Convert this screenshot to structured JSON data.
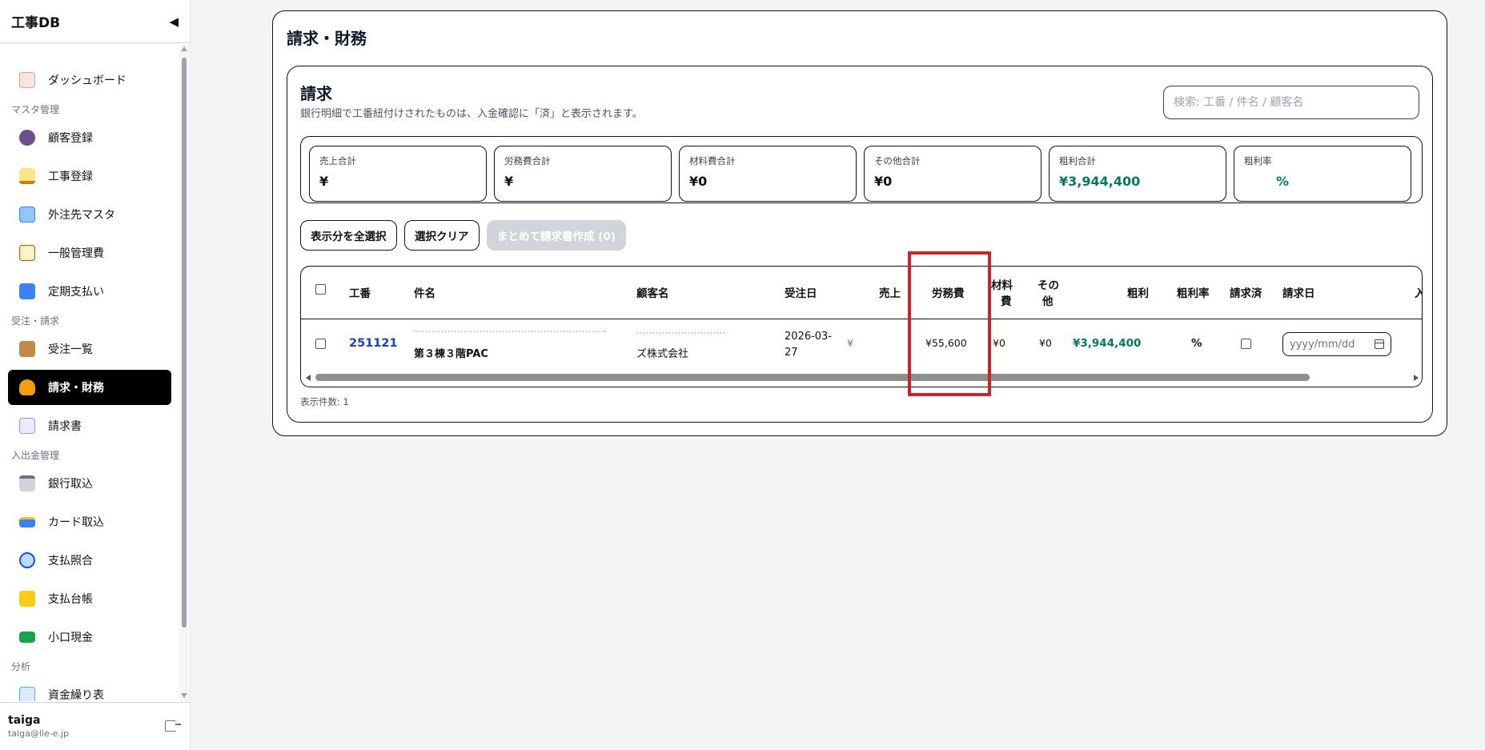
{
  "sidebar": {
    "brand": "工事DB",
    "collapse_glyph": "◀",
    "sections": {
      "master": "マスタ管理",
      "orders": "受注・請求",
      "cash": "入出金管理",
      "analysis": "分析"
    },
    "items": [
      {
        "label": "ダッシュボード",
        "icon": "bar-chart-icon",
        "color": "#e8b4b8"
      },
      {
        "label": "顧客登録",
        "icon": "users-icon",
        "color": "#6d4f8f"
      },
      {
        "label": "工事登録",
        "icon": "construction-icon",
        "color": "#d97706"
      },
      {
        "label": "外注先マスタ",
        "icon": "building-icon",
        "color": "#60a5fa"
      },
      {
        "label": "一般管理費",
        "icon": "clipboard-icon",
        "color": "#e5c07b"
      },
      {
        "label": "定期支払い",
        "icon": "repeat-icon",
        "color": "#3b82f6"
      },
      {
        "label": "受注一覧",
        "icon": "package-icon",
        "color": "#b45309"
      },
      {
        "label": "請求・財務",
        "icon": "money-bag-icon",
        "color": "#f59e0b"
      },
      {
        "label": "請求書",
        "icon": "document-icon",
        "color": "#c4b5fd"
      },
      {
        "label": "銀行取込",
        "icon": "bank-icon",
        "color": "#9ca3af"
      },
      {
        "label": "カード取込",
        "icon": "credit-card-icon",
        "color": "#3b82f6"
      },
      {
        "label": "支払照合",
        "icon": "magnifier-icon",
        "color": "#2563eb"
      },
      {
        "label": "支払台帳",
        "icon": "ledger-icon",
        "color": "#facc15"
      },
      {
        "label": "小口現金",
        "icon": "cash-icon",
        "color": "#16a34a"
      },
      {
        "label": "資金繰り表",
        "icon": "chart-icon",
        "color": "#93c5fd"
      }
    ],
    "active_item": "請求・財務",
    "user": {
      "name": "taiga",
      "email": "taiga@lle-e.jp"
    }
  },
  "page": {
    "title": "請求・財務",
    "section_title": "請求",
    "section_desc": "銀行明細で工番紐付けされたものは、入金確認に「済」と表示されます。",
    "search_placeholder": "検索: 工番 / 件名 / 顧客名"
  },
  "summary": [
    {
      "label": "売上合計",
      "value": "¥"
    },
    {
      "label": "労務費合計",
      "value": "¥"
    },
    {
      "label": "材料費合計",
      "value": "¥0"
    },
    {
      "label": "その他合計",
      "value": "¥0"
    },
    {
      "label": "粗利合計",
      "value": "¥3,944,400"
    },
    {
      "label": "粗利率",
      "value": "%"
    }
  ],
  "buttons": {
    "select_all": "表示分を全選択",
    "clear": "選択クリア",
    "bulk_invoice": "まとめて請求書作成 (0)"
  },
  "table": {
    "headers": {
      "kouban": "工番",
      "kenmei": "件名",
      "customer": "顧客名",
      "order_date": "受注日",
      "sales": "売上",
      "labor": "労務費",
      "material_a": "材料",
      "material_b": "費",
      "other_a": "その",
      "other_b": "他",
      "profit": "粗利",
      "profit_rate": "粗利率",
      "invoiced": "請求済",
      "invoice_date": "請求日",
      "more": "入"
    },
    "rows": [
      {
        "kouban": "251121",
        "kenmei_line2": "第３棟３階PAC",
        "customer_line2": "ズ株式会社",
        "order_date_1": "2026-03-",
        "order_date_2": "27",
        "sales": "¥",
        "labor": "¥55,600",
        "material": "¥0",
        "other": "¥0",
        "profit": "¥3,944,400",
        "profit_rate": "%",
        "invoice_date_placeholder": "yyyy/mm/dd"
      }
    ]
  },
  "footer_count": "表示件数: 1"
}
